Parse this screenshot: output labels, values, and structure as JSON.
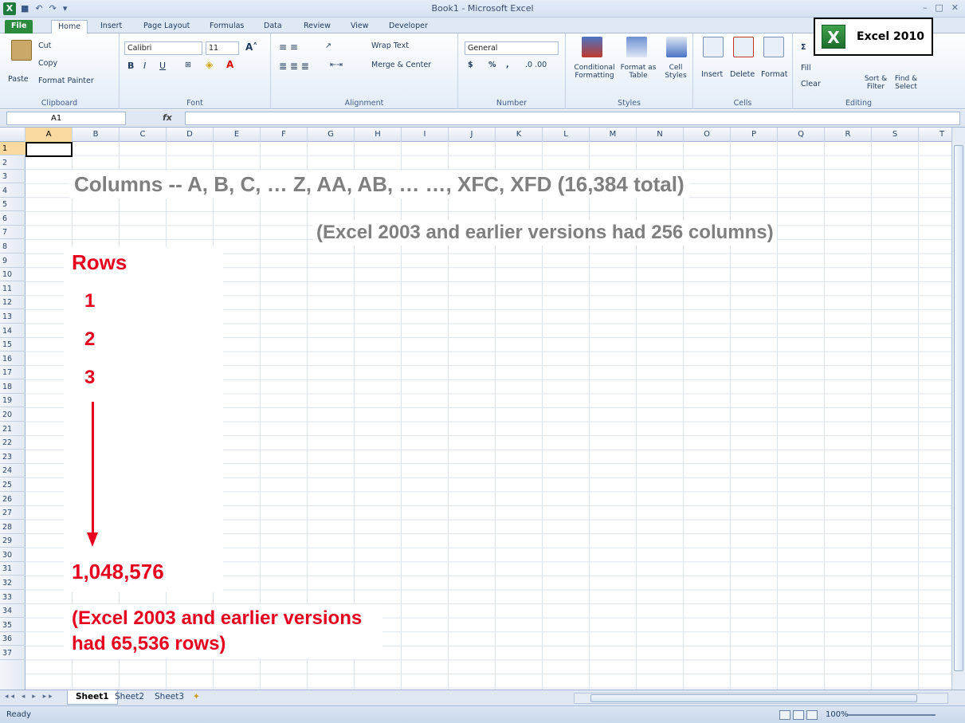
{
  "window": {
    "title": "Book1 - Microsoft Excel",
    "app_icon": "excel-icon",
    "qat": [
      "save-icon",
      "undo-icon",
      "redo-icon",
      "customize-icon"
    ],
    "controls": [
      "minimize-icon",
      "restore-icon",
      "close-icon"
    ]
  },
  "tabs": [
    "File",
    "Home",
    "Insert",
    "Page Layout",
    "Formulas",
    "Data",
    "Review",
    "View",
    "Developer"
  ],
  "active_tab": "Home",
  "ribbon": {
    "clipboard": {
      "label": "Clipboard",
      "paste": "Paste",
      "cut": "Cut",
      "copy": "Copy",
      "format_painter": "Format Painter"
    },
    "font": {
      "label": "Font",
      "font_name": "Calibri",
      "font_size": "11",
      "bold": "B",
      "italic": "I",
      "underline": "U"
    },
    "alignment": {
      "label": "Alignment",
      "wrap_text": "Wrap Text",
      "merge_center": "Merge & Center"
    },
    "number": {
      "label": "Number",
      "format": "General",
      "currency": "$",
      "percent": "%",
      "comma": ","
    },
    "styles": {
      "label": "Styles",
      "conditional": "Conditional Formatting",
      "format_table": "Format as Table",
      "cell_styles": "Cell Styles"
    },
    "cells": {
      "label": "Cells",
      "insert": "Insert",
      "delete": "Delete",
      "format": "Format"
    },
    "editing": {
      "label": "Editing",
      "sum": "Σ",
      "fill": "Fill",
      "clear": "Clear",
      "sort_filter": "Sort & Filter",
      "find_select": "Find & Select"
    }
  },
  "badge": {
    "text": "Excel 2010",
    "logo_letter": "X"
  },
  "formula_bar": {
    "name_box": "A1",
    "fx": "fx",
    "content": ""
  },
  "columns": [
    "A",
    "B",
    "C",
    "D",
    "E",
    "F",
    "G",
    "H",
    "I",
    "J",
    "K",
    "L",
    "M",
    "N",
    "O",
    "P",
    "Q",
    "R",
    "S",
    "T"
  ],
  "rows": [
    "1",
    "2",
    "3",
    "4",
    "5",
    "6",
    "7",
    "8",
    "9",
    "10",
    "11",
    "12",
    "13",
    "14",
    "15",
    "16",
    "17",
    "18",
    "19",
    "20",
    "21",
    "22",
    "23",
    "24",
    "25",
    "26",
    "27",
    "28",
    "29",
    "30",
    "31",
    "32",
    "33",
    "34",
    "35",
    "36",
    "37"
  ],
  "selected_cell": {
    "column": "A",
    "row": "1"
  },
  "annotations": {
    "columns_text": "Columns -- A, B, C, … Z, AA, AB, …      …, XFC, XFD (16,384 total)",
    "columns_note": "(Excel 2003 and earlier versions had 256 columns)",
    "rows_title": "Rows",
    "row_1": "1",
    "row_2": "2",
    "row_3": "3",
    "rows_max": "1,048,576",
    "rows_note": "(Excel 2003 and earlier versions had 65,536 rows)",
    "color": "#e8001f",
    "gray": "#7f7f7f"
  },
  "sheets": [
    "Sheet1",
    "Sheet2",
    "Sheet3"
  ],
  "active_sheet": "Sheet1",
  "status": {
    "ready": "Ready",
    "zoom": "100%"
  }
}
